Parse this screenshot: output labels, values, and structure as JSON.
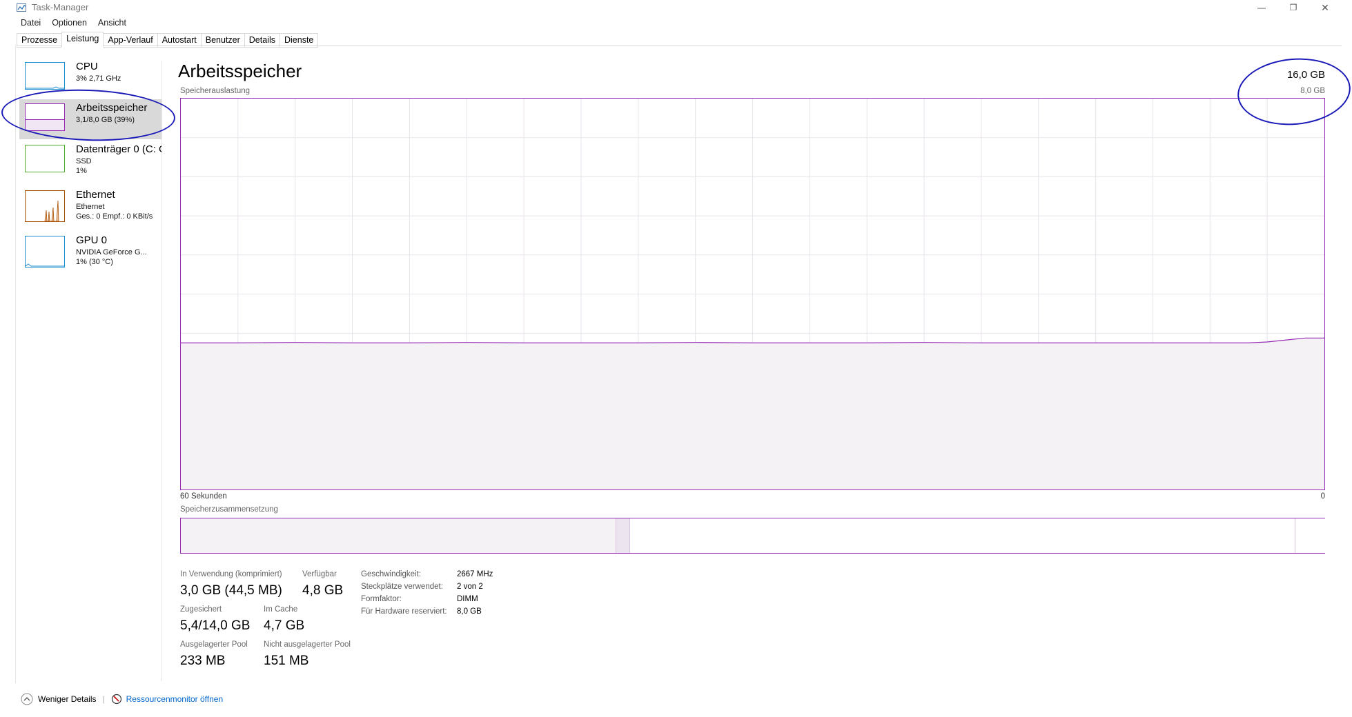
{
  "window": {
    "title": "Task-Manager",
    "minimize": "—",
    "restore": "❐",
    "close": "✕"
  },
  "menu": [
    "Datei",
    "Optionen",
    "Ansicht"
  ],
  "tabs": [
    "Prozesse",
    "Leistung",
    "App-Verlauf",
    "Autostart",
    "Benutzer",
    "Details",
    "Dienste"
  ],
  "active_tab": "Leistung",
  "sidebar": {
    "items": [
      {
        "title": "CPU",
        "line1": "3% 2,71 GHz",
        "line2": "",
        "color": "#1a8ccf"
      },
      {
        "title": "Arbeitsspeicher",
        "line1": "3,1/8,0 GB (39%)",
        "line2": "",
        "color": "#9528b4"
      },
      {
        "title": "Datenträger 0 (C: C",
        "line1": "SSD",
        "line2": "1%",
        "color": "#4daa29"
      },
      {
        "title": "Ethernet",
        "line1": "Ethernet",
        "line2": "Ges.: 0 Empf.: 0 KBit/s",
        "color": "#a74f01"
      },
      {
        "title": "GPU 0",
        "line1": "NVIDIA GeForce G...",
        "line2": "1% (30 °C)",
        "color": "#1a8ccf"
      }
    ]
  },
  "main": {
    "title": "Arbeitsspeicher",
    "total": "16,0 GB",
    "chart_label": "Speicherauslastung",
    "chart_max": "8,0 GB",
    "axis_left": "60 Sekunden",
    "axis_right": "0",
    "composition_label": "Speicherzusammensetzung",
    "accent": "#9528b4",
    "fill": "#f4f2f5"
  },
  "chart_data": {
    "type": "area",
    "ylim": [
      0,
      8
    ],
    "xlim": [
      60,
      0
    ],
    "x": [
      60,
      57,
      54,
      51,
      48,
      45,
      42,
      39,
      36,
      33,
      30,
      27,
      24,
      21,
      18,
      15,
      12,
      9,
      6,
      4,
      3,
      2,
      1,
      0
    ],
    "values": [
      3.0,
      3.0,
      3.01,
      3.0,
      3.0,
      3.01,
      3.0,
      3.0,
      3.0,
      3.01,
      3.0,
      3.0,
      3.0,
      3.01,
      3.0,
      3.0,
      3.0,
      3.0,
      3.0,
      3.0,
      3.02,
      3.06,
      3.1,
      3.1
    ]
  },
  "composition": [
    {
      "fraction": 0.38,
      "kind": "used"
    },
    {
      "fraction": 0.012,
      "kind": "modified"
    },
    {
      "fraction": 0.582,
      "kind": "standby"
    },
    {
      "fraction": 0.026,
      "kind": "free"
    }
  ],
  "stats": {
    "in_use_label": "In Verwendung (komprimiert)",
    "in_use_value": "3,0 GB (44,5 MB)",
    "available_label": "Verfügbar",
    "available_value": "4,8 GB",
    "committed_label": "Zugesichert",
    "committed_value": "5,4/14,0 GB",
    "cached_label": "Im Cache",
    "cached_value": "4,7 GB",
    "paged_label": "Ausgelagerter Pool",
    "paged_value": "233 MB",
    "nonpaged_label": "Nicht ausgelagerter Pool",
    "nonpaged_value": "151 MB"
  },
  "properties": [
    {
      "label": "Geschwindigkeit:",
      "value": "2667 MHz"
    },
    {
      "label": "Steckplätze verwendet:",
      "value": "2 von 2"
    },
    {
      "label": "Formfaktor:",
      "value": "DIMM"
    },
    {
      "label": "Für Hardware reserviert:",
      "value": "8,0 GB"
    }
  ],
  "footer": {
    "less_details": "Weniger Details",
    "separator": "|",
    "resource_monitor": "Ressourcenmonitor öffnen"
  }
}
